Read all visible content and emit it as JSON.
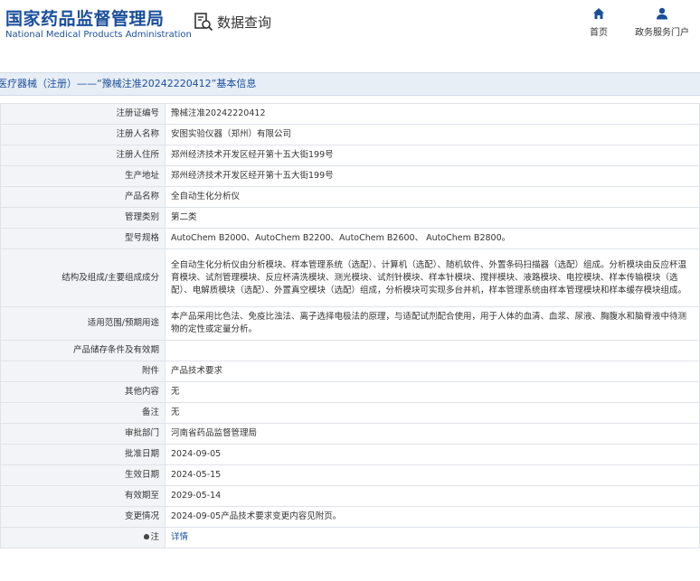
{
  "header": {
    "title_cn": "国家药品监督管理局",
    "title_en": "National Medical Products Administration",
    "query_label": "数据查询",
    "nav": {
      "home": "首页",
      "service": "政务服务门户"
    }
  },
  "breadcrumb": "医疗器械（注册）——“豫械注准20242220412”基本信息",
  "rows": [
    {
      "label": "注册证编号",
      "value": "豫械注准20242220412"
    },
    {
      "label": "注册人名称",
      "value": "安图实验仪器（郑州）有限公司"
    },
    {
      "label": "注册人住所",
      "value": "郑州经济技术开发区经开第十五大街199号"
    },
    {
      "label": "生产地址",
      "value": "郑州经济技术开发区经开第十五大街199号"
    },
    {
      "label": "产品名称",
      "value": "全自动生化分析仪"
    },
    {
      "label": "管理类别",
      "value": "第二类"
    },
    {
      "label": "型号规格",
      "value": "AutoChem B2000、AutoChem B2200、AutoChem B2600、 AutoChem B2800。"
    },
    {
      "label": "结构及组成/主要组成成分",
      "value": "全自动生化分析仪由分析模块、样本管理系统（选配）、计算机（选配）、随机软件、外置条码扫描器（选配）组成。分析模块由反应杯温育模块、试剂管理模块、反应杯清洗模块、测光模块、试剂针模块、样本针模块、搅拌模块、液路模块、电控模块、样本传输模块（选配）、电解质模块（选配）、外置真空模块（选配）组成，分析模块可实现多台并机，样本管理系统由样本管理模块和样本缓存模块组成。"
    },
    {
      "label": "适用范围/预期用途",
      "value": "本产品采用比色法、免疫比浊法、离子选择电极法的原理，与适配试剂配合使用，用于人体的血清、血浆、尿液、胸腹水和脑脊液中待测物的定性或定量分析。"
    },
    {
      "label": "产品储存条件及有效期",
      "value": ""
    },
    {
      "label": "附件",
      "value": "产品技术要求"
    },
    {
      "label": "其他内容",
      "value": "无"
    },
    {
      "label": "备注",
      "value": "无"
    },
    {
      "label": "审批部门",
      "value": "河南省药品监督管理局"
    },
    {
      "label": "批准日期",
      "value": "2024-09-05"
    },
    {
      "label": "生效日期",
      "value": "2024-05-15"
    },
    {
      "label": "有效期至",
      "value": "2029-05-14"
    },
    {
      "label": "变更情况",
      "value": "2024-09-05产品技术要求变更内容见附页。"
    },
    {
      "label": "注",
      "value": "详情"
    }
  ],
  "colors": {
    "brand": "#1a4f9c",
    "label_bg": "#f2f4f7",
    "crumb_bg": "#e8eef6"
  }
}
